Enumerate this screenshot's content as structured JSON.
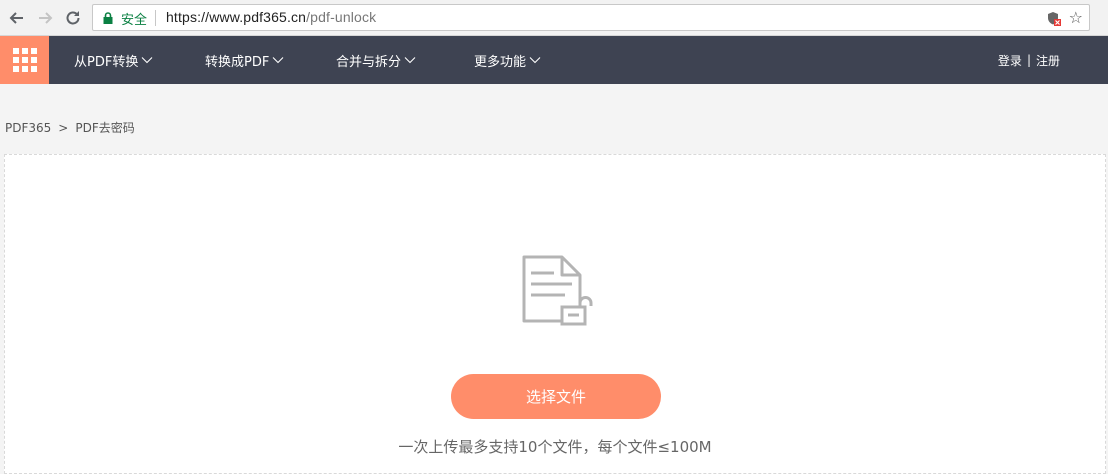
{
  "browser": {
    "secure_label": "安全",
    "url_host": "https://www.pdf365.cn",
    "url_path": "/pdf-unlock"
  },
  "nav": {
    "menu": [
      "从PDF转换",
      "转换成PDF",
      "合并与拆分",
      "更多功能"
    ],
    "login": "登录",
    "separator": "|",
    "register": "注册",
    "accent_color": "#ff8d6a",
    "bg_color": "#3e4352"
  },
  "breadcrumb": {
    "home": "PDF365",
    "separator": ">",
    "current": "PDF去密码"
  },
  "upload": {
    "button_label": "选择文件",
    "hint": "一次上传最多支持10个文件，每个文件≤100M",
    "icon": "pdf-unlock-file-icon"
  }
}
